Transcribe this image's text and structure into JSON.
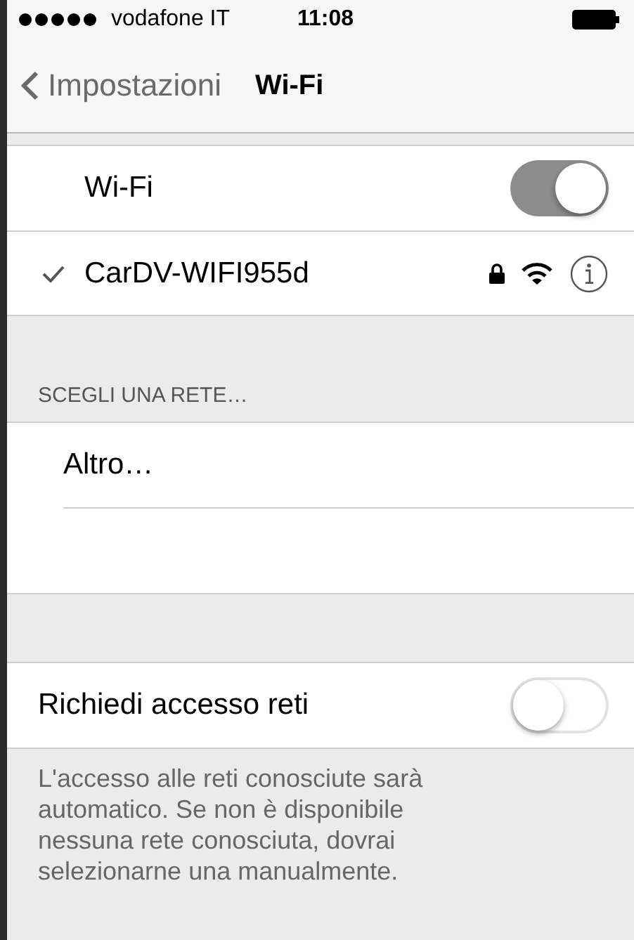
{
  "status_bar": {
    "carrier": "vodafone IT",
    "time": "11:08"
  },
  "nav": {
    "back": "Impostazioni",
    "title": "Wi-Fi"
  },
  "wifi": {
    "label": "Wi-Fi",
    "on": true
  },
  "networks": [
    {
      "name": "CarDV-WIFI955d",
      "selected": true,
      "locked": true
    }
  ],
  "choose": {
    "header": "SCEGLI UNA RETE…",
    "items": [
      {
        "label": "Altro…"
      }
    ]
  },
  "ask": {
    "label": "Richiedi accesso reti",
    "on": false,
    "footer": "L'accesso alle reti conosciute sarà automatico. Se non è disponibile nessuna rete conosciuta, dovrai selezionarne una manualmente."
  }
}
